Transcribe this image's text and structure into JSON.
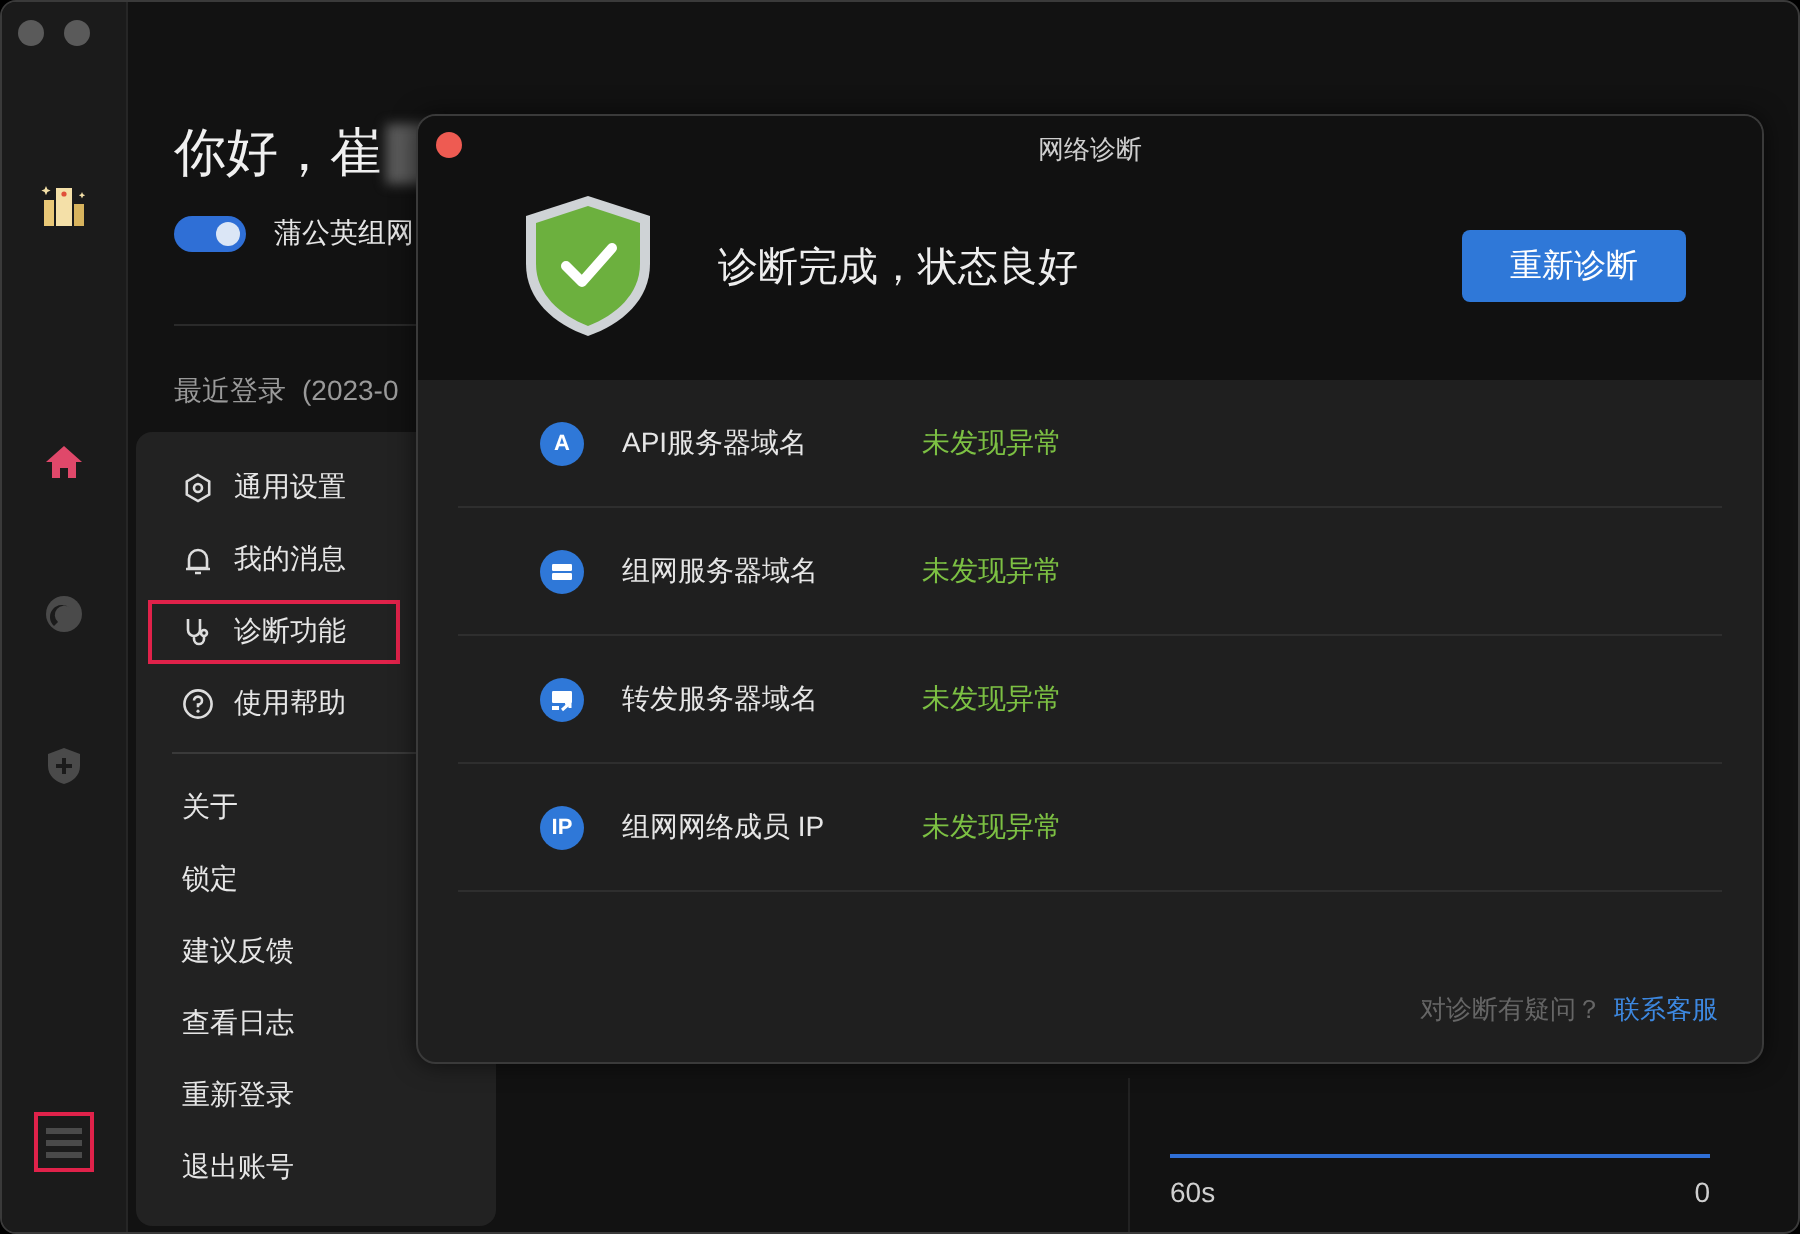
{
  "sidebar": {
    "nav": [
      {
        "kind": "home",
        "selected": true
      },
      {
        "kind": "circle",
        "selected": false
      },
      {
        "kind": "shield",
        "selected": false
      }
    ],
    "menu_button": {
      "highlighted": true
    }
  },
  "greeting": "你好，崔",
  "toggle": {
    "label": "蒲公英组网",
    "on": true
  },
  "recent_login": {
    "label": "最近登录",
    "value": "(2023-0"
  },
  "traffic": {
    "start_label": "60s",
    "end_label": "0"
  },
  "menu": {
    "items": [
      {
        "kind": "settings",
        "label": "通用设置",
        "highlighted": false
      },
      {
        "kind": "bell",
        "label": "我的消息",
        "highlighted": false
      },
      {
        "kind": "stethoscope",
        "label": "诊断功能",
        "highlighted": true
      },
      {
        "kind": "help",
        "label": "使用帮助",
        "highlighted": false
      }
    ],
    "plain_items": [
      "关于",
      "锁定",
      "建议反馈",
      "查看日志",
      "重新登录",
      "退出账号"
    ]
  },
  "dialog": {
    "title": "网络诊断",
    "status": "诊断完成，状态良好",
    "button": "重新诊断",
    "checks": [
      {
        "kind": "letter",
        "icon_label": "A",
        "name": "API服务器域名",
        "result": "未发现异常"
      },
      {
        "kind": "server",
        "name": "组网服务器域名",
        "result": "未发现异常"
      },
      {
        "kind": "relay",
        "name": "转发服务器域名",
        "result": "未发现异常"
      },
      {
        "kind": "letter",
        "icon_label": "IP",
        "name": "组网网络成员 IP",
        "result": "未发现异常"
      }
    ],
    "footer_text": "对诊断有疑问？",
    "footer_link": "联系客服"
  }
}
